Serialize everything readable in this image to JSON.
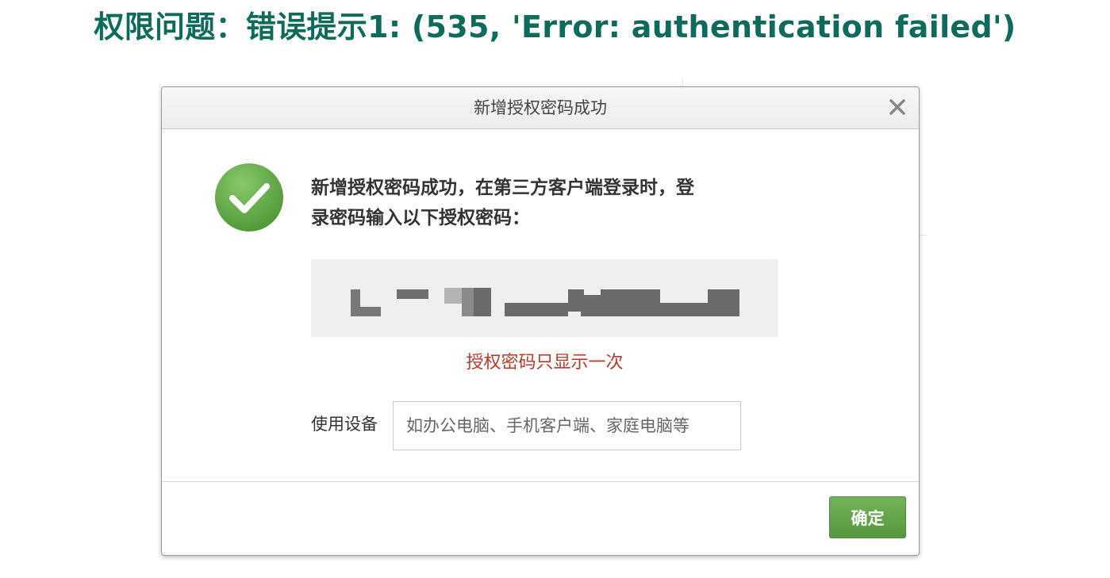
{
  "page": {
    "title": "权限问题：错误提示1: (535, 'Error: authentication failed')"
  },
  "dialog": {
    "title": "新增授权密码成功",
    "message_line1": "新增授权密码成功，在第三方客户端登录时，登",
    "message_line2": "录密码输入以下授权密码：",
    "password_notice": "授权密码只显示一次",
    "device_label": "使用设备",
    "device_placeholder": "如办公电脑、手机客户端、家庭电脑等",
    "confirm_label": "确定"
  },
  "colors": {
    "title": "#0e6b5c",
    "success": "#5aa63f",
    "notice": "#b83a2a",
    "button": "#5fa046"
  },
  "icons": {
    "close": "close-icon",
    "success": "check-circle-icon"
  }
}
